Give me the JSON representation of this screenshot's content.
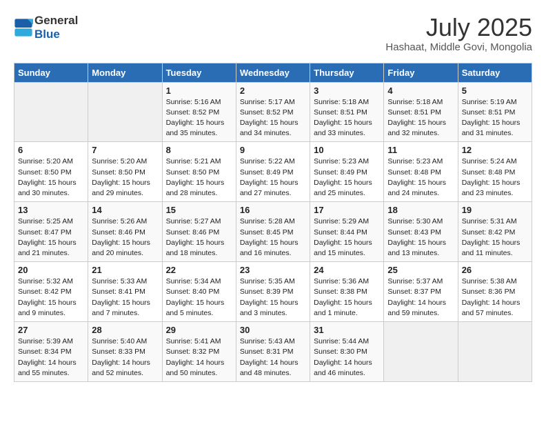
{
  "logo": {
    "text_general": "General",
    "text_blue": "Blue"
  },
  "header": {
    "month_year": "July 2025",
    "location": "Hashaat, Middle Govi, Mongolia"
  },
  "days_of_week": [
    "Sunday",
    "Monday",
    "Tuesday",
    "Wednesday",
    "Thursday",
    "Friday",
    "Saturday"
  ],
  "weeks": [
    [
      {
        "day": "",
        "content": ""
      },
      {
        "day": "",
        "content": ""
      },
      {
        "day": "1",
        "content": "Sunrise: 5:16 AM\nSunset: 8:52 PM\nDaylight: 15 hours and 35 minutes."
      },
      {
        "day": "2",
        "content": "Sunrise: 5:17 AM\nSunset: 8:52 PM\nDaylight: 15 hours and 34 minutes."
      },
      {
        "day": "3",
        "content": "Sunrise: 5:18 AM\nSunset: 8:51 PM\nDaylight: 15 hours and 33 minutes."
      },
      {
        "day": "4",
        "content": "Sunrise: 5:18 AM\nSunset: 8:51 PM\nDaylight: 15 hours and 32 minutes."
      },
      {
        "day": "5",
        "content": "Sunrise: 5:19 AM\nSunset: 8:51 PM\nDaylight: 15 hours and 31 minutes."
      }
    ],
    [
      {
        "day": "6",
        "content": "Sunrise: 5:20 AM\nSunset: 8:50 PM\nDaylight: 15 hours and 30 minutes."
      },
      {
        "day": "7",
        "content": "Sunrise: 5:20 AM\nSunset: 8:50 PM\nDaylight: 15 hours and 29 minutes."
      },
      {
        "day": "8",
        "content": "Sunrise: 5:21 AM\nSunset: 8:50 PM\nDaylight: 15 hours and 28 minutes."
      },
      {
        "day": "9",
        "content": "Sunrise: 5:22 AM\nSunset: 8:49 PM\nDaylight: 15 hours and 27 minutes."
      },
      {
        "day": "10",
        "content": "Sunrise: 5:23 AM\nSunset: 8:49 PM\nDaylight: 15 hours and 25 minutes."
      },
      {
        "day": "11",
        "content": "Sunrise: 5:23 AM\nSunset: 8:48 PM\nDaylight: 15 hours and 24 minutes."
      },
      {
        "day": "12",
        "content": "Sunrise: 5:24 AM\nSunset: 8:48 PM\nDaylight: 15 hours and 23 minutes."
      }
    ],
    [
      {
        "day": "13",
        "content": "Sunrise: 5:25 AM\nSunset: 8:47 PM\nDaylight: 15 hours and 21 minutes."
      },
      {
        "day": "14",
        "content": "Sunrise: 5:26 AM\nSunset: 8:46 PM\nDaylight: 15 hours and 20 minutes."
      },
      {
        "day": "15",
        "content": "Sunrise: 5:27 AM\nSunset: 8:46 PM\nDaylight: 15 hours and 18 minutes."
      },
      {
        "day": "16",
        "content": "Sunrise: 5:28 AM\nSunset: 8:45 PM\nDaylight: 15 hours and 16 minutes."
      },
      {
        "day": "17",
        "content": "Sunrise: 5:29 AM\nSunset: 8:44 PM\nDaylight: 15 hours and 15 minutes."
      },
      {
        "day": "18",
        "content": "Sunrise: 5:30 AM\nSunset: 8:43 PM\nDaylight: 15 hours and 13 minutes."
      },
      {
        "day": "19",
        "content": "Sunrise: 5:31 AM\nSunset: 8:42 PM\nDaylight: 15 hours and 11 minutes."
      }
    ],
    [
      {
        "day": "20",
        "content": "Sunrise: 5:32 AM\nSunset: 8:42 PM\nDaylight: 15 hours and 9 minutes."
      },
      {
        "day": "21",
        "content": "Sunrise: 5:33 AM\nSunset: 8:41 PM\nDaylight: 15 hours and 7 minutes."
      },
      {
        "day": "22",
        "content": "Sunrise: 5:34 AM\nSunset: 8:40 PM\nDaylight: 15 hours and 5 minutes."
      },
      {
        "day": "23",
        "content": "Sunrise: 5:35 AM\nSunset: 8:39 PM\nDaylight: 15 hours and 3 minutes."
      },
      {
        "day": "24",
        "content": "Sunrise: 5:36 AM\nSunset: 8:38 PM\nDaylight: 15 hours and 1 minute."
      },
      {
        "day": "25",
        "content": "Sunrise: 5:37 AM\nSunset: 8:37 PM\nDaylight: 14 hours and 59 minutes."
      },
      {
        "day": "26",
        "content": "Sunrise: 5:38 AM\nSunset: 8:36 PM\nDaylight: 14 hours and 57 minutes."
      }
    ],
    [
      {
        "day": "27",
        "content": "Sunrise: 5:39 AM\nSunset: 8:34 PM\nDaylight: 14 hours and 55 minutes."
      },
      {
        "day": "28",
        "content": "Sunrise: 5:40 AM\nSunset: 8:33 PM\nDaylight: 14 hours and 52 minutes."
      },
      {
        "day": "29",
        "content": "Sunrise: 5:41 AM\nSunset: 8:32 PM\nDaylight: 14 hours and 50 minutes."
      },
      {
        "day": "30",
        "content": "Sunrise: 5:43 AM\nSunset: 8:31 PM\nDaylight: 14 hours and 48 minutes."
      },
      {
        "day": "31",
        "content": "Sunrise: 5:44 AM\nSunset: 8:30 PM\nDaylight: 14 hours and 46 minutes."
      },
      {
        "day": "",
        "content": ""
      },
      {
        "day": "",
        "content": ""
      }
    ]
  ]
}
